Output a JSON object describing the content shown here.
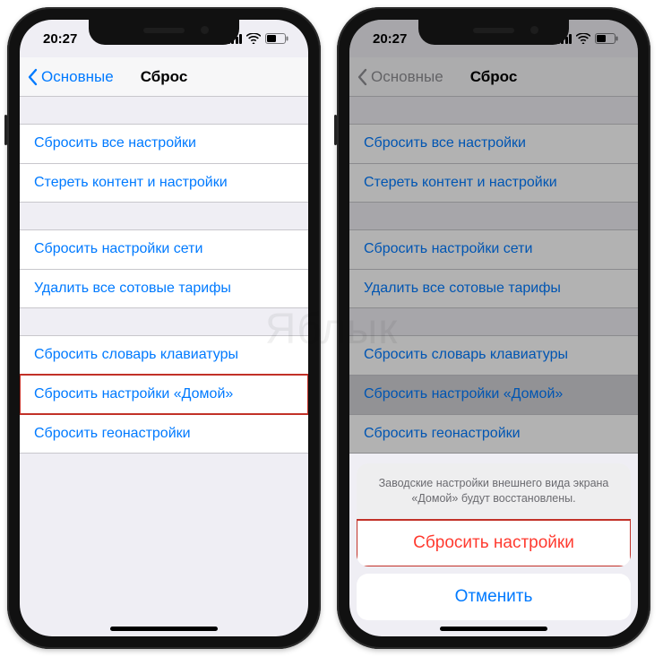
{
  "watermark": "Яблык",
  "status": {
    "time": "20:27"
  },
  "nav": {
    "back": "Основные",
    "title": "Сброс"
  },
  "groups": [
    {
      "rows": [
        "Сбросить все настройки",
        "Стереть контент и настройки"
      ]
    },
    {
      "rows": [
        "Сбросить настройки сети",
        "Удалить все сотовые тарифы"
      ]
    },
    {
      "rows": [
        "Сбросить словарь клавиатуры",
        "Сбросить настройки «Домой»",
        "Сбросить геонастройки"
      ]
    }
  ],
  "sheet": {
    "message": "Заводские настройки внешнего вида экрана «Домой» будут восстановлены.",
    "confirm": "Сбросить настройки",
    "cancel": "Отменить"
  }
}
